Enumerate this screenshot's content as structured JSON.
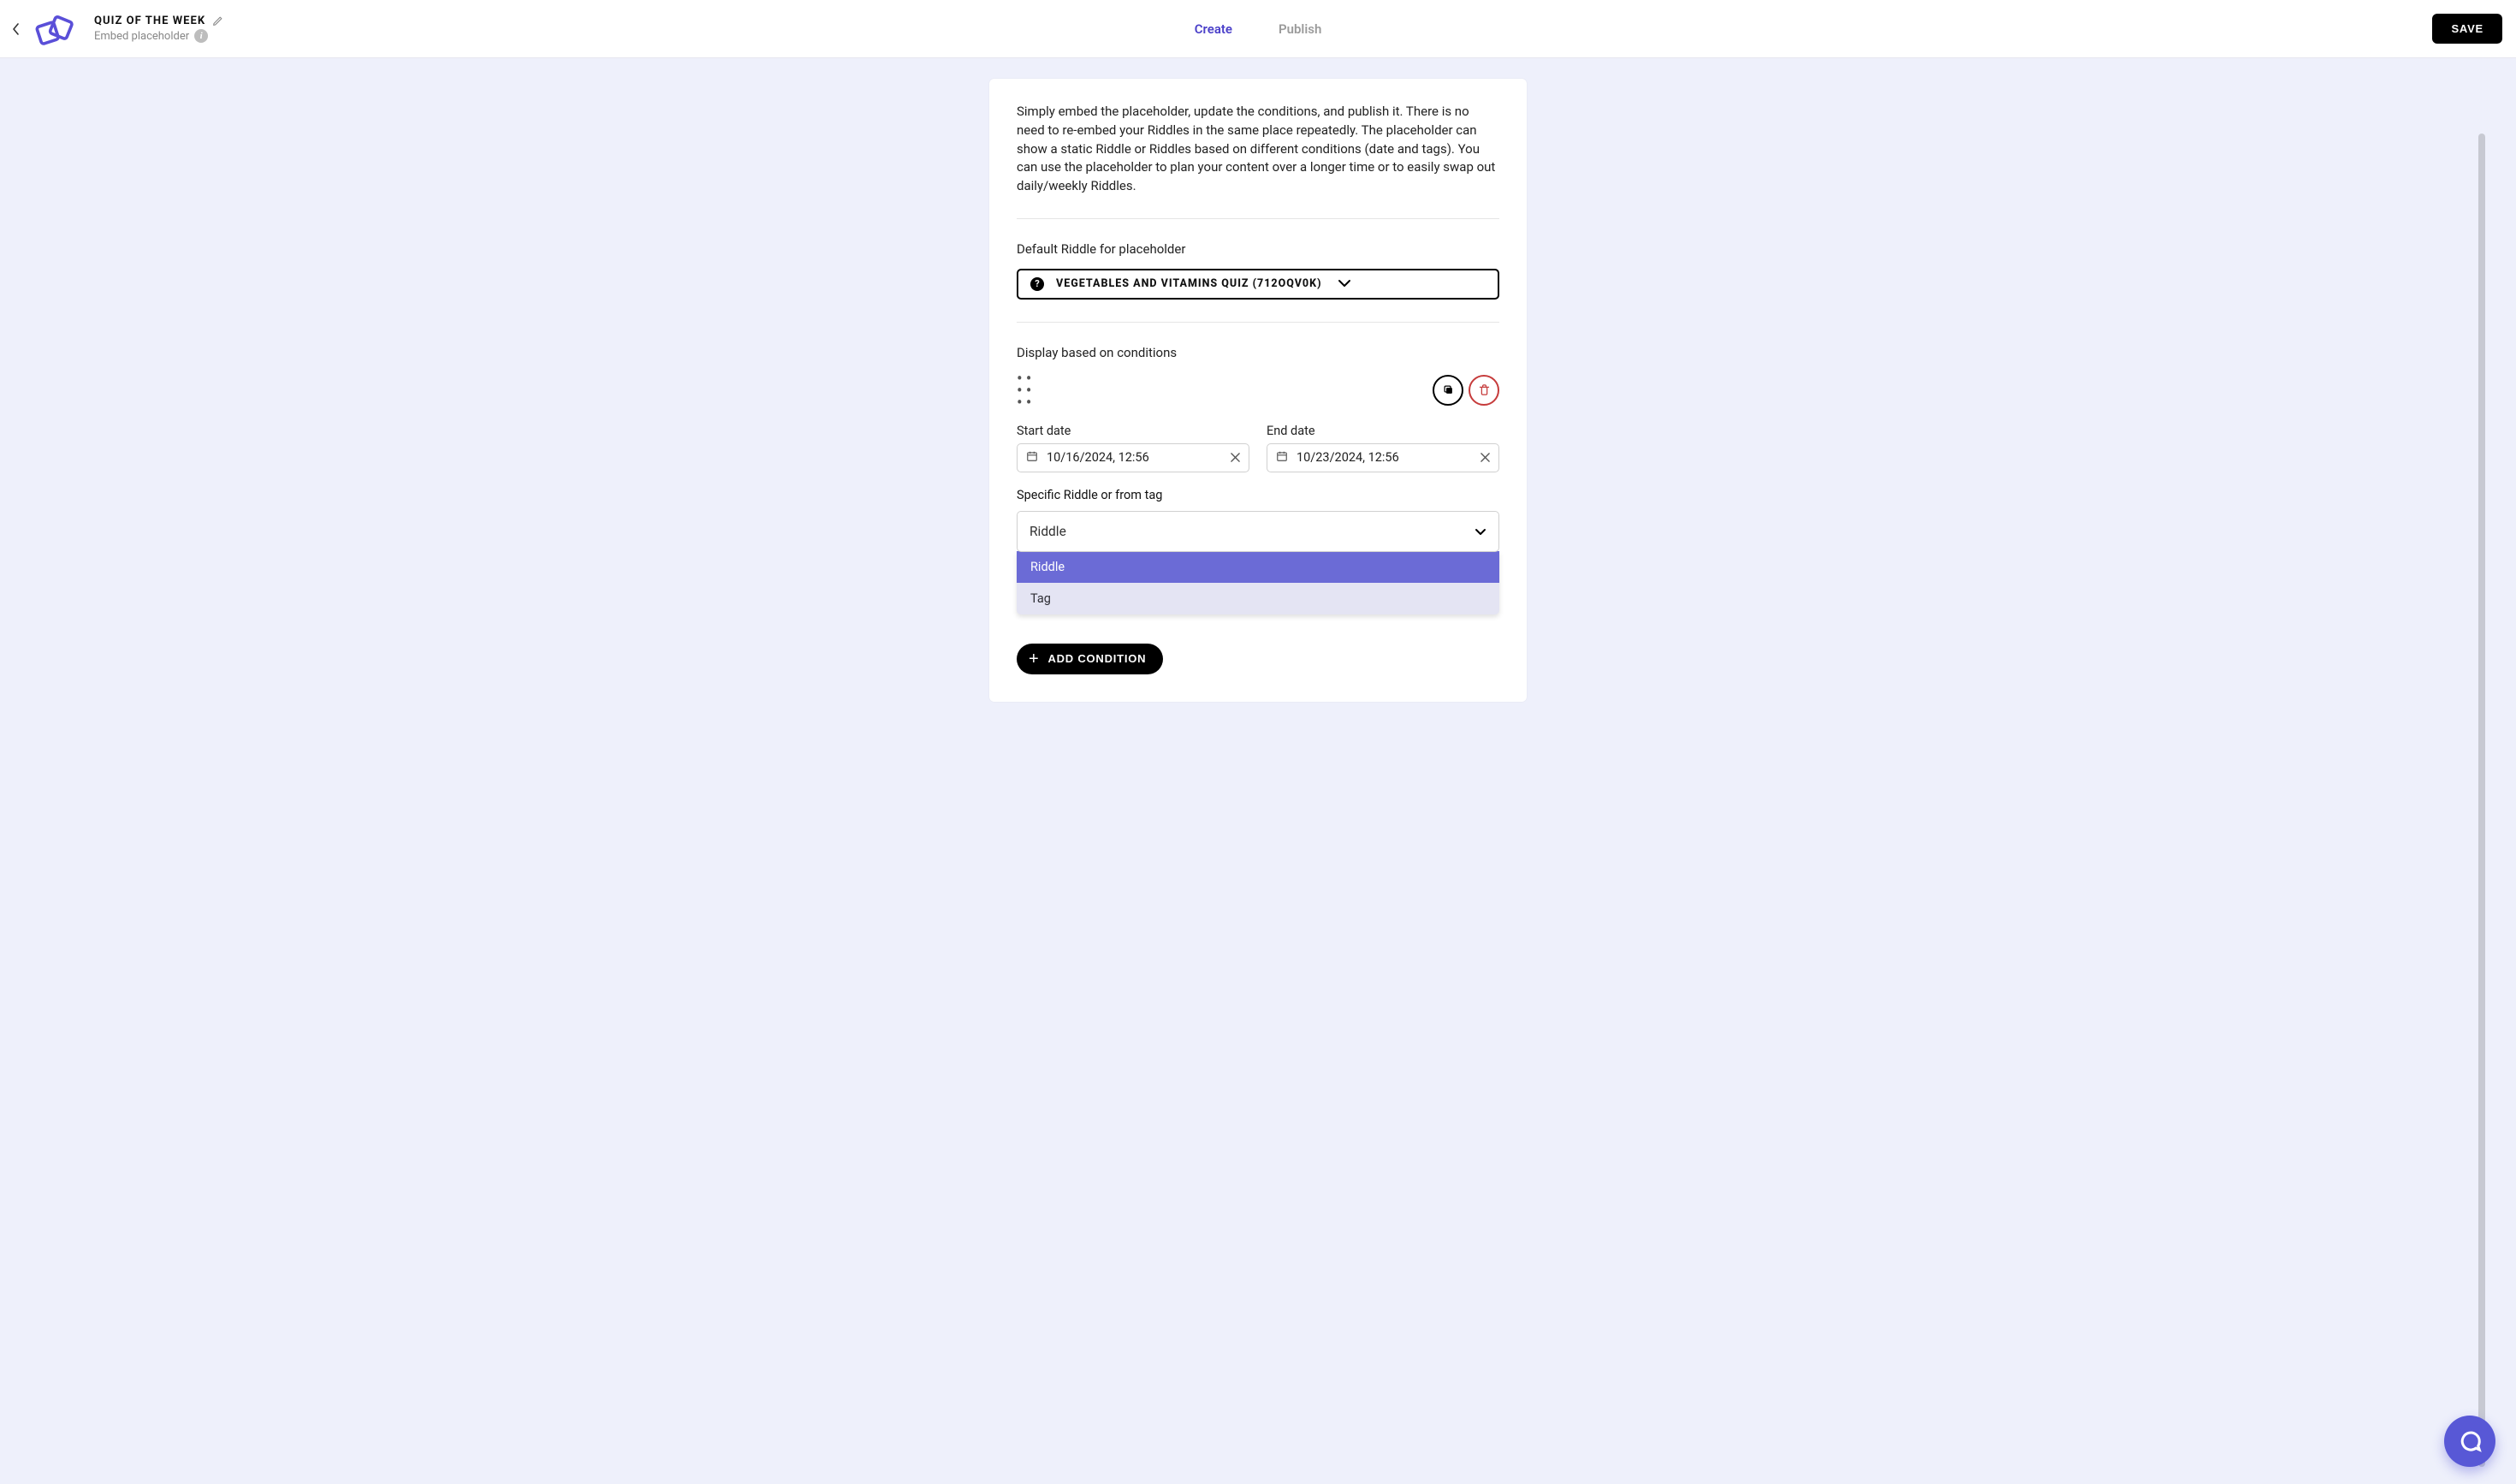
{
  "header": {
    "title": "QUIZ OF THE WEEK",
    "subtitle": "Embed placeholder",
    "tabs": {
      "create": "Create",
      "publish": "Publish"
    },
    "save_label": "SAVE"
  },
  "panel": {
    "intro": "Simply embed the placeholder, update the conditions, and publish it. There is no need to re-embed your Riddles in the same place repeatedly. The placeholder can show a static Riddle or Riddles based on different conditions (date and tags). You can use the placeholder to plan your content over a longer time or to easily swap out daily/weekly Riddles.",
    "default_label": "Default Riddle for placeholder",
    "default_riddle": "VEGETABLES AND VITAMINS QUIZ (712OQV0K)",
    "conditions_label": "Display based on conditions",
    "start_date_label": "Start date",
    "start_date_value": "10/16/2024, 12:56",
    "end_date_label": "End date",
    "end_date_value": "10/23/2024, 12:56",
    "specific_label": "Specific Riddle or from tag",
    "dd_value": "Riddle",
    "dd_options": {
      "riddle": "Riddle",
      "tag": "Tag"
    },
    "add_condition_label": "ADD CONDITION"
  }
}
